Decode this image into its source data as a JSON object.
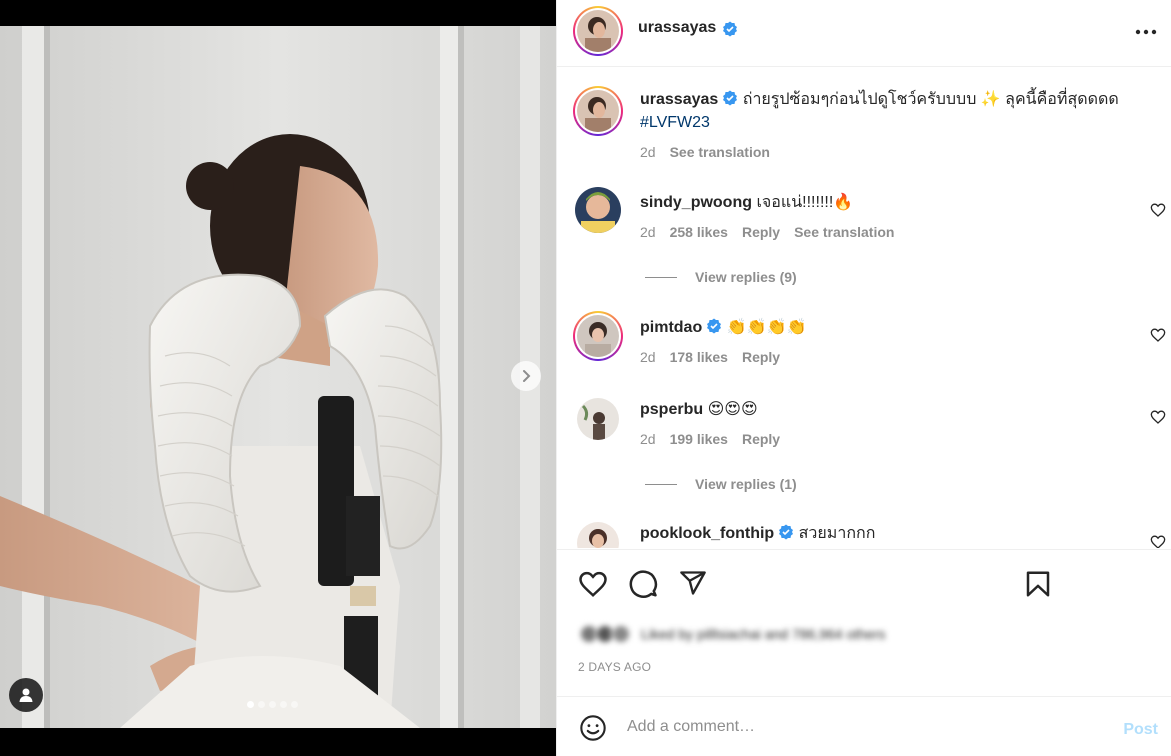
{
  "post": {
    "author": "urassayas",
    "more_icon": "more-horizontal-icon"
  },
  "media": {
    "carousel_count": 5,
    "active_index": 0
  },
  "caption": {
    "username": "urassayas",
    "text": "ถ่ายรูปซ้อมๆก่อนไปดูโชว์ครับบบบ ✨ ลุคนี้คือที่สุดดดด",
    "hashtag": "#LVFW23",
    "time": "2d",
    "see_translation": "See translation"
  },
  "comments": [
    {
      "username": "sindy_pwoong",
      "text": "เจอแน่!!!!!!!🔥",
      "time": "2d",
      "likes": "258 likes",
      "reply": "Reply",
      "see_translation": "See translation",
      "view_replies": "View replies (9)"
    },
    {
      "username": "pimtdao",
      "text": "👏👏👏👏",
      "time": "2d",
      "likes": "178 likes",
      "reply": "Reply"
    },
    {
      "username": "psperbu",
      "text": "😍😍😍",
      "time": "2d",
      "likes": "199 likes",
      "reply": "Reply",
      "view_replies": "View replies (1)"
    },
    {
      "username": "pooklook_fonthip",
      "text": "สวยมากกก"
    }
  ],
  "actions": {
    "liked_by": "Liked by pilllsiachai and 786,964 others",
    "time_ago": "2 DAYS AGO"
  },
  "add_comment": {
    "placeholder": "Add a comment…",
    "post_label": "Post"
  },
  "colors": {
    "verified": "#3897f0",
    "link": "#00376b",
    "post_disabled": "#b2dffc"
  }
}
